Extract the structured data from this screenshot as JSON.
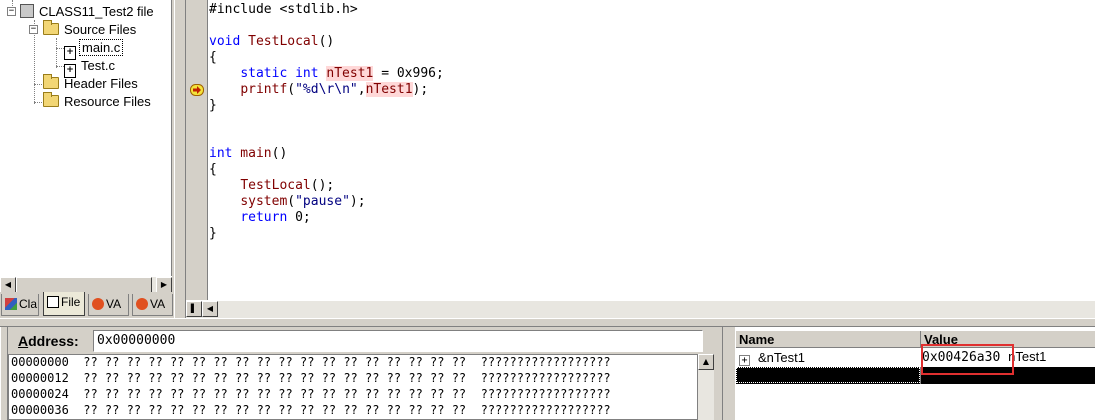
{
  "tree": {
    "project": "CLASS11_Test2 file",
    "source_folder": "Source Files",
    "files": [
      "main.c",
      "Test.c"
    ],
    "header_folder": "Header Files",
    "resource_folder": "Resource Files",
    "expander_minus": "−",
    "file_glyph": "+"
  },
  "workspace_tabs": [
    "Cla",
    "File",
    "VA",
    "VA"
  ],
  "editor": {
    "lines": [
      {
        "p": "#include <stdlib.h>"
      },
      {
        "p": ""
      },
      {
        "kw": "void",
        "fn": " TestLocal",
        "p": "()"
      },
      {
        "p": "{"
      },
      {
        "ind": "    ",
        "kw": "static int",
        "hl": "nTest1",
        "p": " = 0x996;"
      },
      {
        "ind": "    ",
        "fn": "printf",
        "p": "(",
        "str": "\"%d\\r\\n\"",
        "p2": ",",
        "hl": "nTest1",
        "p3": ");"
      },
      {
        "p": "}"
      },
      {
        "p": ""
      },
      {
        "p": ""
      },
      {
        "kw": "int",
        "fn": " main",
        "p": "()"
      },
      {
        "p": "{"
      },
      {
        "ind": "    ",
        "fn": "TestLocal",
        "p": "();"
      },
      {
        "ind": "    ",
        "fn": "system",
        "p": "(",
        "str": "\"pause\"",
        "p3": ");"
      },
      {
        "ind": "    ",
        "kw": "return",
        "p": " 0;"
      },
      {
        "p": "}"
      }
    ],
    "breakpoint_line": 5
  },
  "memory": {
    "address_label_u": "A",
    "address_label_rest": "ddress:",
    "address_value": "0x00000000",
    "rows": [
      {
        "addr": "00000000",
        "bytes": "?? ?? ?? ?? ?? ?? ?? ?? ?? ?? ?? ?? ?? ?? ?? ?? ?? ??",
        "ascii": "??????????????????"
      },
      {
        "addr": "00000012",
        "bytes": "?? ?? ?? ?? ?? ?? ?? ?? ?? ?? ?? ?? ?? ?? ?? ?? ?? ??",
        "ascii": "??????????????????"
      },
      {
        "addr": "00000024",
        "bytes": "?? ?? ?? ?? ?? ?? ?? ?? ?? ?? ?? ?? ?? ?? ?? ?? ?? ??",
        "ascii": "??????????????????"
      },
      {
        "addr": "00000036",
        "bytes": "?? ?? ?? ?? ?? ?? ?? ?? ?? ?? ?? ?? ?? ?? ?? ?? ?? ??",
        "ascii": "??????????????????"
      }
    ]
  },
  "watch": {
    "col_name": "Name",
    "col_value": "Value",
    "rows": [
      {
        "expander": "+",
        "name": "&nTest1",
        "value": "0x00426a30",
        "value_suffix": "nTest1"
      }
    ]
  },
  "colors": {
    "highlight_box": "#e03030",
    "keyword": "#0000ff",
    "function": "#800000",
    "string": "#000080"
  }
}
